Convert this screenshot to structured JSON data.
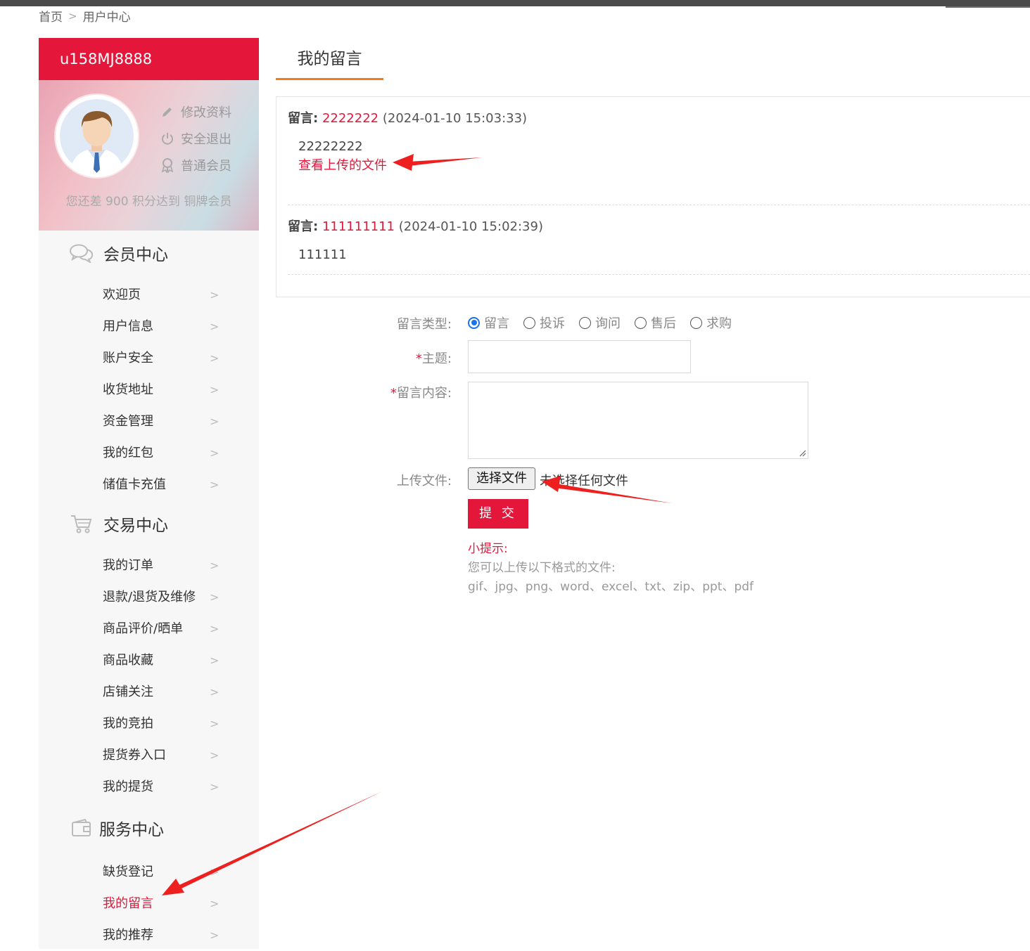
{
  "breadcrumb": {
    "home": "首页",
    "separator": ">",
    "current": "用户中心"
  },
  "user": {
    "username": "u158MJ8888",
    "links": [
      {
        "icon": "pencil-icon",
        "label": "修改资料"
      },
      {
        "icon": "power-icon",
        "label": "安全退出"
      },
      {
        "icon": "medal-icon",
        "label": "普通会员"
      }
    ],
    "points_note": "您还差 900 积分达到 铜牌会员"
  },
  "sections": [
    {
      "icon": "chat-icon",
      "title": "会员中心",
      "items": [
        "欢迎页",
        "用户信息",
        "账户安全",
        "收货地址",
        "资金管理",
        "我的红包",
        "储值卡充值"
      ]
    },
    {
      "icon": "cart-icon",
      "title": "交易中心",
      "items": [
        "我的订单",
        "退款/退货及维修",
        "商品评价/晒单",
        "商品收藏",
        "店铺关注",
        "我的竞拍",
        "提货券入口",
        "我的提货"
      ]
    },
    {
      "icon": "wallet-icon",
      "title": "服务中心",
      "items": [
        "缺货登记",
        "我的留言",
        "我的推荐"
      ]
    }
  ],
  "active_item": "我的留言",
  "page_title": "我的留言",
  "messages": [
    {
      "label": "留言:",
      "title": "2222222",
      "time": "(2024-01-10 15:03:33)",
      "content": "22222222",
      "link": "查看上传的文件"
    },
    {
      "label": "留言:",
      "title": "111111111",
      "time": "(2024-01-10 15:02:39)",
      "content": "111111",
      "link": ""
    }
  ],
  "form": {
    "type_label": "留言类型:",
    "types": [
      "留言",
      "投诉",
      "询问",
      "售后",
      "求购"
    ],
    "selected_type": "留言",
    "subject_label": "主题:",
    "content_label": "留言内容:",
    "required_mark": "*",
    "upload_label": "上传文件:",
    "file_button": "选择文件",
    "file_none": "未选择任何文件",
    "submit": "提 交"
  },
  "tips": {
    "title": "小提示:",
    "line1": "您可以上传以下格式的文件:",
    "line2": "gif、jpg、png、word、excel、txt、zip、ppt、pdf"
  },
  "colors": {
    "brand_red": "#e4173a",
    "tab_orange": "#f07c1a",
    "radio_blue": "#1a73e8",
    "annotation_red": "#ee1f1f"
  }
}
